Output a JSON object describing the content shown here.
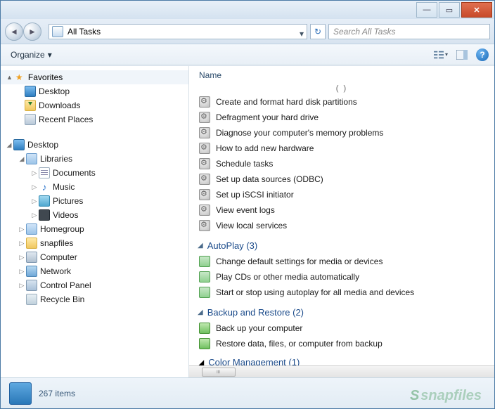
{
  "window": {
    "minimize": "—",
    "maximize": "▭",
    "close": "✕"
  },
  "address": {
    "path": "All Tasks"
  },
  "search": {
    "placeholder": "Search All Tasks"
  },
  "toolbar": {
    "organize": "Organize"
  },
  "nav": {
    "favorites": {
      "header": "Favorites",
      "items": [
        {
          "label": "Desktop",
          "icon": "desktop"
        },
        {
          "label": "Downloads",
          "icon": "download"
        },
        {
          "label": "Recent Places",
          "icon": "recent"
        }
      ]
    },
    "tree": [
      {
        "label": "Desktop",
        "icon": "desktop",
        "depth": 0,
        "expanded": true
      },
      {
        "label": "Libraries",
        "icon": "libs",
        "depth": 1,
        "expanded": true
      },
      {
        "label": "Documents",
        "icon": "doc",
        "depth": 2,
        "expandable": true
      },
      {
        "label": "Music",
        "icon": "music",
        "depth": 2,
        "expandable": true
      },
      {
        "label": "Pictures",
        "icon": "pic",
        "depth": 2,
        "expandable": true
      },
      {
        "label": "Videos",
        "icon": "vid",
        "depth": 2,
        "expandable": true
      },
      {
        "label": "Homegroup",
        "icon": "home",
        "depth": 1,
        "expandable": true
      },
      {
        "label": "snapfiles",
        "icon": "folder",
        "depth": 1,
        "expandable": true
      },
      {
        "label": "Computer",
        "icon": "comp",
        "depth": 1,
        "expandable": true
      },
      {
        "label": "Network",
        "icon": "net",
        "depth": 1,
        "expandable": true
      },
      {
        "label": "Control Panel",
        "icon": "cpl",
        "depth": 1,
        "expandable": true
      },
      {
        "label": "Recycle Bin",
        "icon": "bin",
        "depth": 1,
        "expandable": false
      }
    ]
  },
  "content": {
    "column": "Name",
    "ellipsis": "(  )",
    "ungrouped": [
      "Create and format hard disk partitions",
      "Defragment your hard drive",
      "Diagnose your computer's memory problems",
      "How to add new hardware",
      "Schedule tasks",
      "Set up data sources (ODBC)",
      "Set up iSCSI initiator",
      "View event logs",
      "View local services"
    ],
    "groups": [
      {
        "title": "AutoPlay (3)",
        "icon": "media",
        "items": [
          "Change default settings for media or devices",
          "Play CDs or other media automatically",
          "Start or stop using autoplay for all media and devices"
        ]
      },
      {
        "title": "Backup and Restore (2)",
        "icon": "backup",
        "items": [
          "Back up your computer",
          "Restore data, files, or computer from backup"
        ]
      }
    ],
    "cutoff_group": "Color Management (1)"
  },
  "status": {
    "count": "267 items"
  },
  "watermark": "snapfiles"
}
